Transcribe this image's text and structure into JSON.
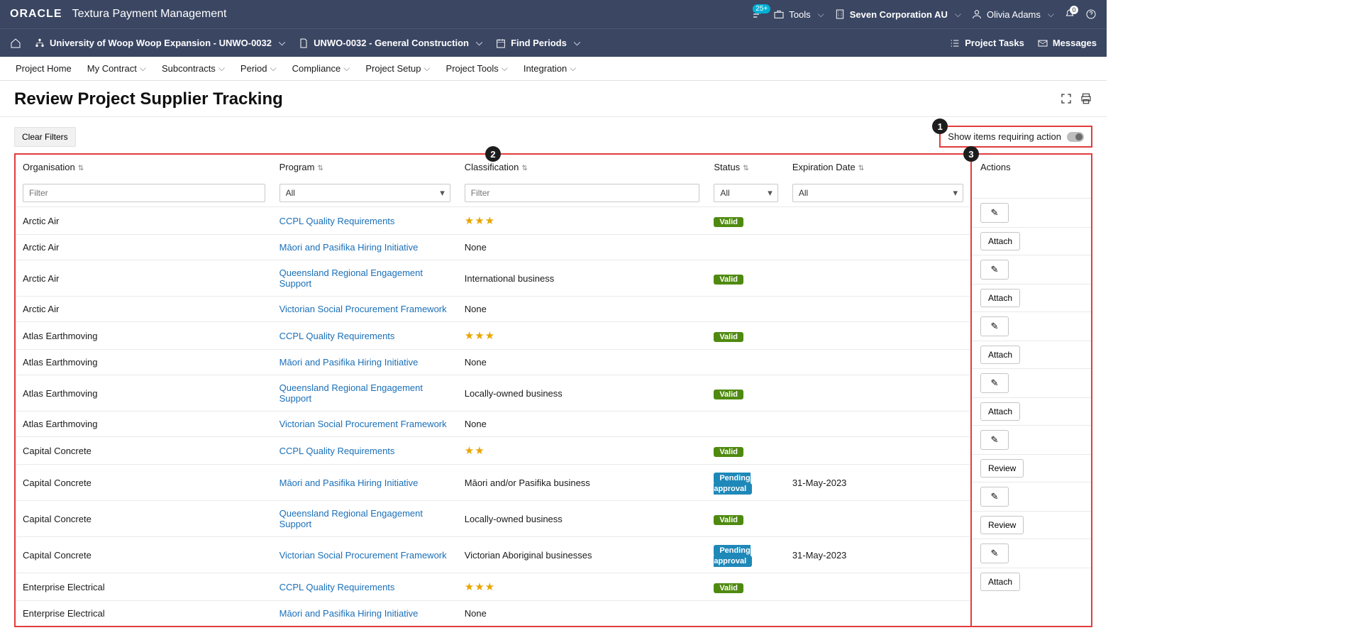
{
  "topbar": {
    "brand": "ORACLE",
    "app": "Textura Payment Management",
    "tasks_badge": "25+",
    "tools": "Tools",
    "org": "Seven Corporation AU",
    "user": "Olivia Adams",
    "notif": "0"
  },
  "secondbar": {
    "project": "University of Woop Woop Expansion - UNWO-0032",
    "contract": "UNWO-0032 - General Construction",
    "periods": "Find Periods",
    "project_tasks": "Project Tasks",
    "messages": "Messages"
  },
  "menubar": {
    "items": [
      "Project Home",
      "My Contract",
      "Subcontracts",
      "Period",
      "Compliance",
      "Project Setup",
      "Project Tools",
      "Integration"
    ]
  },
  "page": {
    "title": "Review Project Supplier Tracking",
    "clear_filters": "Clear Filters",
    "toggle_label": "Show items requiring action"
  },
  "markers": {
    "one": "1",
    "two": "2",
    "three": "3"
  },
  "table": {
    "headers": {
      "organisation": "Organisation",
      "program": "Program",
      "classification": "Classification",
      "status": "Status",
      "expiration": "Expiration Date",
      "actions": "Actions"
    },
    "filters": {
      "org_placeholder": "Filter",
      "program_all": "All",
      "class_placeholder": "Filter",
      "status_all": "All",
      "exp_all": "All"
    },
    "action_labels": {
      "attach": "Attach",
      "review": "Review"
    },
    "rows": [
      {
        "org": "Arctic Air",
        "program": "CCPL Quality Requirements",
        "classification": "stars3",
        "status": "valid",
        "exp": "",
        "action": "edit"
      },
      {
        "org": "Arctic Air",
        "program": "Māori and Pasifika Hiring Initiative",
        "classification": "None",
        "status": "",
        "exp": "",
        "action": "attach"
      },
      {
        "org": "Arctic Air",
        "program": "Queensland Regional Engagement Support",
        "classification": "International business",
        "status": "valid",
        "exp": "",
        "action": "edit"
      },
      {
        "org": "Arctic Air",
        "program": "Victorian Social Procurement Framework",
        "classification": "None",
        "status": "",
        "exp": "",
        "action": "attach"
      },
      {
        "org": "Atlas Earthmoving",
        "program": "CCPL Quality Requirements",
        "classification": "stars3",
        "status": "valid",
        "exp": "",
        "action": "edit"
      },
      {
        "org": "Atlas Earthmoving",
        "program": "Māori and Pasifika Hiring Initiative",
        "classification": "None",
        "status": "",
        "exp": "",
        "action": "attach"
      },
      {
        "org": "Atlas Earthmoving",
        "program": "Queensland Regional Engagement Support",
        "classification": "Locally-owned business",
        "status": "valid",
        "exp": "",
        "action": "edit"
      },
      {
        "org": "Atlas Earthmoving",
        "program": "Victorian Social Procurement Framework",
        "classification": "None",
        "status": "",
        "exp": "",
        "action": "attach"
      },
      {
        "org": "Capital Concrete",
        "program": "CCPL Quality Requirements",
        "classification": "stars2",
        "status": "valid",
        "exp": "",
        "action": "edit"
      },
      {
        "org": "Capital Concrete",
        "program": "Māori and Pasifika Hiring Initiative",
        "classification": "Māori and/or Pasifika business",
        "status": "pending",
        "exp": "31-May-2023",
        "action": "review"
      },
      {
        "org": "Capital Concrete",
        "program": "Queensland Regional Engagement Support",
        "classification": "Locally-owned business",
        "status": "valid",
        "exp": "",
        "action": "edit"
      },
      {
        "org": "Capital Concrete",
        "program": "Victorian Social Procurement Framework",
        "classification": "Victorian Aboriginal businesses",
        "status": "pending",
        "exp": "31-May-2023",
        "action": "review"
      },
      {
        "org": "Enterprise Electrical",
        "program": "CCPL Quality Requirements",
        "classification": "stars3",
        "status": "valid",
        "exp": "",
        "action": "edit"
      },
      {
        "org": "Enterprise Electrical",
        "program": "Māori and Pasifika Hiring Initiative",
        "classification": "None",
        "status": "",
        "exp": "",
        "action": "attach"
      }
    ],
    "status_labels": {
      "valid": "Valid",
      "pending": "Pending approval"
    }
  }
}
